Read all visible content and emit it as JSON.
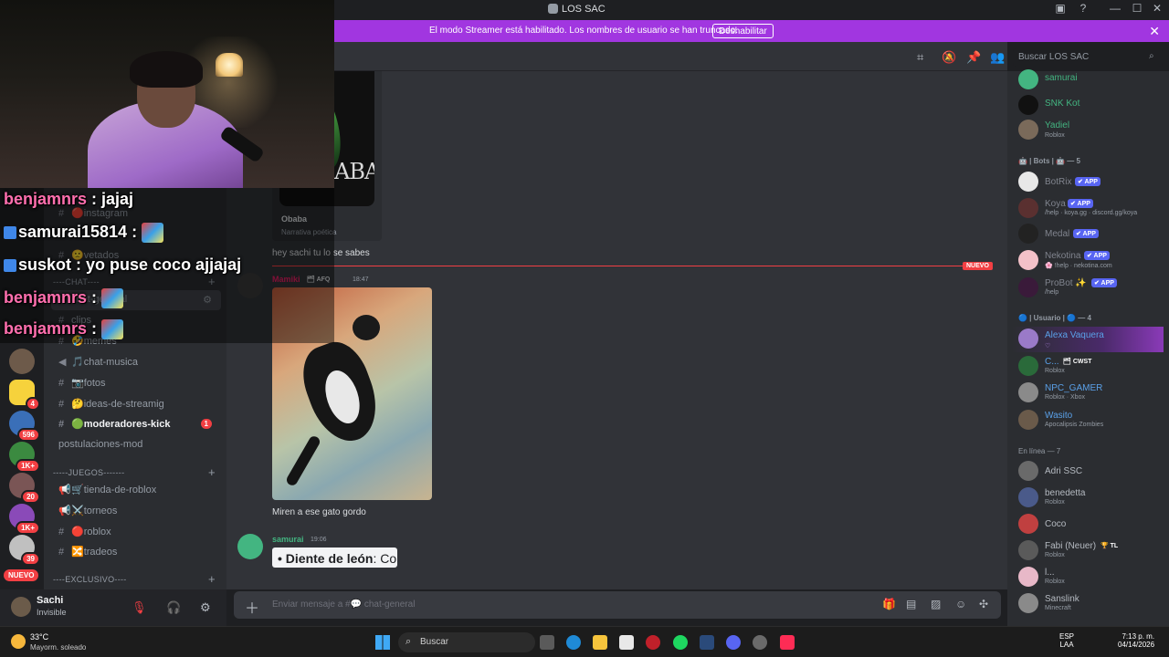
{
  "window": {
    "title": "LOS SAC",
    "min": "—",
    "max": "☐",
    "close": "✕"
  },
  "banner": {
    "message": "El modo Streamer está habilitado. Los nombres de usuario se han truncado.",
    "button": "Deshabilitar"
  },
  "server_rail": {
    "badges": [
      "4",
      "596",
      "1K+",
      "20",
      "1K+",
      "39"
    ],
    "new_label": "NUEVO"
  },
  "channels": {
    "items": [
      {
        "name": "instagram",
        "icon": "🔴"
      },
      {
        "name": "vetados",
        "icon": "🙁"
      }
    ],
    "chat_category": "----CHAT----",
    "chat_items": [
      {
        "name": "chat-general",
        "icon": ""
      },
      {
        "name": "clips",
        "icon": ""
      },
      {
        "name": "memes",
        "icon": "🤣"
      },
      {
        "name": "chat-musica",
        "icon": "🎵"
      },
      {
        "name": "fotos",
        "icon": "📷"
      },
      {
        "name": "ideas-de-streamig",
        "icon": "🤔"
      },
      {
        "name": "moderadores-kick",
        "icon": "🟢",
        "badge": "1"
      },
      {
        "name": "postulaciones-mod",
        "icon": ""
      }
    ],
    "juegos_category": "-----JUEGOS-------",
    "juegos_items": [
      {
        "name": "tienda-de-roblox",
        "icon": "🛒"
      },
      {
        "name": "torneos",
        "icon": "⚔️"
      },
      {
        "name": "roblox",
        "icon": "🔴"
      },
      {
        "name": "tradeos",
        "icon": "🔀"
      }
    ],
    "exclusivo_category": "----EXCLUSIVO----"
  },
  "user_panel": {
    "name": "Sachi",
    "status": "Invisible"
  },
  "search": {
    "placeholder": "Buscar LOS SAC"
  },
  "messages": {
    "embed_title": "Obaba",
    "embed_desc": "Narrativa poética",
    "embed_cover": "ABA",
    "line1": "hey sachi tu lo se sabes",
    "new_label": "NUEVO",
    "msg2_user": "Mamiki",
    "msg2_tag": "🗂 AFQ",
    "msg2_time": "18:47",
    "msg2_text": "Miren a ese gato gordo",
    "msg3_user": "samurai",
    "msg3_time": "19:06",
    "msg3_embed_bold": "Diente de león",
    "msg3_embed_rest": ": Co"
  },
  "composer": {
    "placeholder": "Enviar mensaje a #💬 chat-general"
  },
  "members": {
    "top": [
      {
        "name": "samurai",
        "sub": "",
        "color": "#43b581"
      },
      {
        "name": "SNK Kot",
        "sub": "",
        "color": "#43b581"
      },
      {
        "name": "Yadiel",
        "sub": "Roblox",
        "color": "#43b581"
      }
    ],
    "bots_header": "🤖 | Bots | 🤖 — 5",
    "bots": [
      {
        "name": "BotRix",
        "sub": ""
      },
      {
        "name": "Koya",
        "sub": "/help · koya.gg · discord.gg/koya"
      },
      {
        "name": "Medal",
        "sub": ""
      },
      {
        "name": "Nekotina",
        "sub": "🌸 !help · nekotina.com"
      },
      {
        "name": "ProBot ✨",
        "sub": "/help"
      }
    ],
    "app_label": "✔ APP",
    "users_header": "🔵 | Usuario | 🔵 — 4",
    "users": [
      {
        "name": "Alexa Vaquera",
        "sub": "♡"
      },
      {
        "name": "C...",
        "sub": "Roblox",
        "tag": "🗂 CWST"
      },
      {
        "name": "NPC_GAMER",
        "sub": "Roblox · Xbox"
      },
      {
        "name": "Wasito",
        "sub": "Apocalipsis Zombies"
      }
    ],
    "online_header": "En línea — 7",
    "online": [
      {
        "name": "Adri SSC",
        "sub": ""
      },
      {
        "name": "benedetta",
        "sub": "Roblox"
      },
      {
        "name": "Coco",
        "sub": ""
      },
      {
        "name": "Fabi (Neuer)",
        "sub": "Roblox",
        "tag": "🏆 TL"
      },
      {
        "name": "l...",
        "sub": "Roblox"
      },
      {
        "name": "Sanslink",
        "sub": "Minecraft"
      }
    ]
  },
  "overlay_chat": [
    {
      "user": "benjamnrs",
      "text": " : jajaj",
      "emote": false,
      "icon": false
    },
    {
      "user": "samurai15814",
      "text": " : ",
      "emote": true,
      "icon": true
    },
    {
      "user": "suskot",
      "text": " : yo puse coco ajjajaj",
      "emote": false,
      "icon": true
    },
    {
      "user": "benjamnrs",
      "text": " : ",
      "emote": true,
      "icon": false
    },
    {
      "user": "benjamnrs",
      "text": " : ",
      "emote": true,
      "icon": false
    }
  ],
  "taskbar": {
    "temp": "33°C",
    "weather": "Mayorm. soleado",
    "search": "Buscar",
    "lang1": "ESP",
    "lang2": "LAA",
    "time": "7:13 p. m.",
    "date": "04/14/2026"
  }
}
